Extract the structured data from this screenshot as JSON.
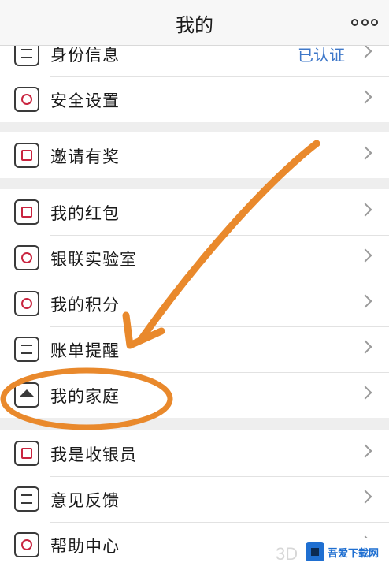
{
  "header": {
    "title": "我的",
    "more_icon": "more-dots-icon"
  },
  "groups": [
    {
      "items": [
        {
          "label": "身份信息",
          "value": "已认证",
          "icon": "id-card-icon"
        },
        {
          "label": "安全设置",
          "value": "",
          "icon": "shield-icon"
        }
      ]
    },
    {
      "items": [
        {
          "label": "邀请有奖",
          "value": "",
          "icon": "gift-envelope-icon"
        }
      ]
    },
    {
      "items": [
        {
          "label": "我的红包",
          "value": "",
          "icon": "red-packet-icon"
        },
        {
          "label": "银联实验室",
          "value": "",
          "icon": "lightbulb-icon"
        },
        {
          "label": "我的积分",
          "value": "",
          "icon": "points-icon"
        },
        {
          "label": "账单提醒",
          "value": "",
          "icon": "bill-icon"
        },
        {
          "label": "我的家庭",
          "value": "",
          "icon": "home-icon"
        }
      ]
    },
    {
      "items": [
        {
          "label": "我是收银员",
          "value": "",
          "icon": "cashier-icon"
        },
        {
          "label": "意见反馈",
          "value": "",
          "icon": "feedback-icon"
        },
        {
          "label": "帮助中心",
          "value": "",
          "icon": "help-icon"
        }
      ]
    }
  ],
  "watermark": {
    "brand": "吾爱下载网",
    "corner_text": "3D",
    "accent": "#1f6fd1"
  },
  "colors": {
    "accent_blue": "#3f78c9",
    "icon_red": "#c9243f",
    "annotation_orange": "#e9892c"
  }
}
